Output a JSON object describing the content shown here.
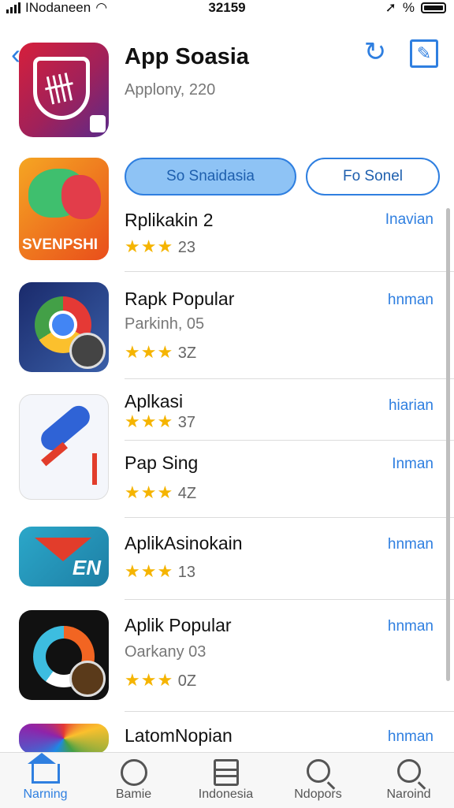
{
  "status_bar": {
    "carrier": "INodaneen",
    "time": "32159",
    "percent": "%"
  },
  "header": {
    "title": "App Soasia",
    "subtitle": "Applony, 220"
  },
  "buttons": {
    "primary": "So Snaidasia",
    "secondary": "Fo Sonel"
  },
  "apps": [
    {
      "name": "Rplikakin 2",
      "sub": "",
      "rating": "23",
      "action": "Inavian"
    },
    {
      "name": "Rapk Popular",
      "sub": "Parkinh, 05",
      "rating": "3Z",
      "action": "hnman"
    },
    {
      "name": "Aplkasi",
      "sub": "",
      "rating": "37",
      "action": "hiarian"
    },
    {
      "name": "Pap Sing",
      "sub": "",
      "rating": "4Z",
      "action": "Inman"
    },
    {
      "name": "AplikAsinokain",
      "sub": "",
      "rating": "13",
      "action": "hnman"
    },
    {
      "name": "Aplik Popular",
      "sub": "Oarkany 03",
      "rating": "0Z",
      "action": "hnman"
    },
    {
      "name": "LatomNopian",
      "sub": "",
      "rating": "",
      "action": "hnman"
    }
  ],
  "icon_labels": {
    "star_app": "SVENPSHI",
    "mail_app": "EN"
  },
  "tabs": [
    {
      "label": "Narning",
      "icon": "home-icon"
    },
    {
      "label": "Bamie",
      "icon": "person-icon"
    },
    {
      "label": "Indonesia",
      "icon": "list-icon"
    },
    {
      "label": "Ndopors",
      "icon": "search-icon"
    },
    {
      "label": "Naroind",
      "icon": "search-icon"
    }
  ],
  "colors": {
    "accent": "#2f7fe0",
    "star": "#f5b400"
  }
}
